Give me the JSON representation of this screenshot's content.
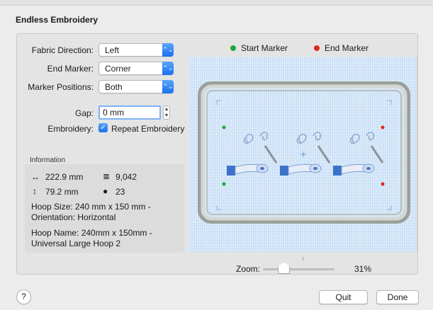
{
  "dialog": {
    "title": "Endless Embroidery"
  },
  "form": {
    "fabric_direction": {
      "label": "Fabric Direction:",
      "value": "Left"
    },
    "end_marker": {
      "label": "End Marker:",
      "value": "Corner"
    },
    "marker_positions": {
      "label": "Marker Positions:",
      "value": "Both"
    },
    "gap": {
      "label": "Gap:",
      "value": "0 mm"
    },
    "embroidery": {
      "label": "Embroidery:",
      "checkbox_label": "Repeat Embroidery",
      "checked": true
    }
  },
  "information": {
    "heading": "Information",
    "width": "222.9 mm",
    "height": "79.2 mm",
    "stitches": "9,042",
    "colors": "23",
    "hoop_size": "Hoop Size: 240 mm x 150 mm - Orientation: Horizontal",
    "hoop_name": "Hoop Name: 240mm x 150mm - Universal Large Hoop 2"
  },
  "legend": {
    "start_marker": "Start Marker",
    "end_marker": "End Marker",
    "start_color": "#1fa83a",
    "end_color": "#e0271c"
  },
  "zoom": {
    "label": "Zoom:",
    "value": "31%",
    "level_fraction": 0.3
  },
  "buttons": {
    "quit": "Quit",
    "done": "Done",
    "help": "?"
  },
  "colors": {
    "accent": "#1a6ff0",
    "fabric": "#cfe3f8"
  }
}
